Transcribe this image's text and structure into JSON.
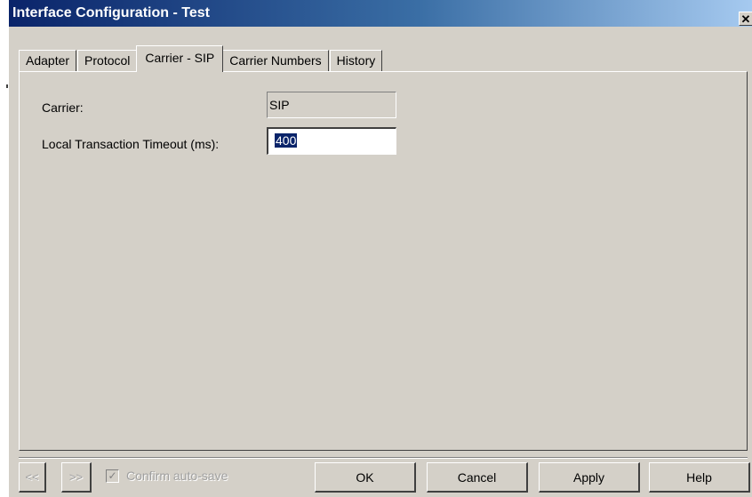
{
  "window": {
    "title": "Interface Configuration - Test",
    "close_glyph": "✕"
  },
  "tabs": [
    {
      "label": "Adapter",
      "active": false
    },
    {
      "label": "Protocol",
      "active": false
    },
    {
      "label": "Carrier - SIP",
      "active": true
    },
    {
      "label": "Carrier Numbers",
      "active": false
    },
    {
      "label": "History",
      "active": false
    }
  ],
  "form": {
    "carrier_label": "Carrier:",
    "carrier_value": "SIP",
    "timeout_label": "Local Transaction Timeout (ms):",
    "timeout_value": "400"
  },
  "footer": {
    "prev_label": "<<",
    "next_label": ">>",
    "autosave_label": "Confirm auto-save",
    "autosave_checked": true,
    "ok_label": "OK",
    "cancel_label": "Cancel",
    "apply_label": "Apply",
    "help_label": "Help"
  },
  "colors": {
    "dialog_face": "#d4d0c8",
    "titlebar_start": "#0a246a",
    "titlebar_end": "#a6caf0",
    "selection": "#0a246a"
  },
  "icons": {
    "close": "close-icon",
    "checkmark": "checkmark-icon"
  }
}
